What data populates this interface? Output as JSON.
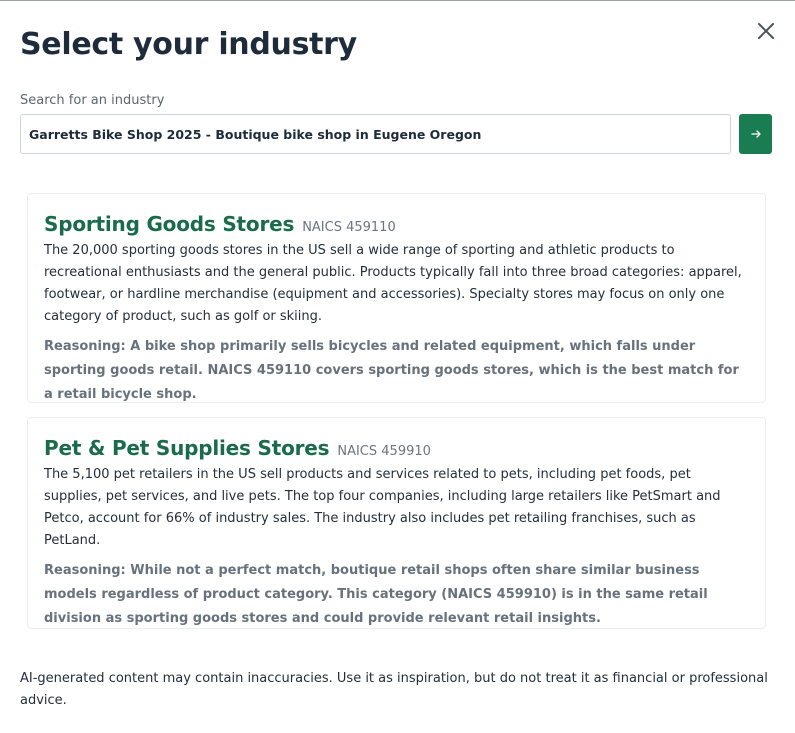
{
  "modal": {
    "title": "Select your industry",
    "close_icon": "close-icon"
  },
  "search": {
    "label": "Search for an industry",
    "value": "Garretts Bike Shop 2025 - Boutique bike shop in Eugene Oregon",
    "submit_icon": "arrow-right-icon",
    "accent_color": "#1a7d52"
  },
  "results": [
    {
      "title": "Sporting Goods Stores",
      "naics": "NAICS 459110",
      "description": "The 20,000 sporting goods stores in the US sell a wide range of sporting and athletic products to recreational enthusiasts and the general public. Products typically fall into three broad categories: apparel, footwear, or hardline merchandise (equipment and accessories). Specialty stores may focus on only one category of product, such as golf or skiing.",
      "reasoning": "Reasoning: A bike shop primarily sells bicycles and related equipment, which falls under sporting goods retail. NAICS 459110 covers sporting goods stores, which is the best match for a retail bicycle shop."
    },
    {
      "title": "Pet & Pet Supplies Stores",
      "naics": "NAICS 459910",
      "description": "The 5,100 pet retailers in the US sell products and services related to pets, including pet foods, pet supplies, pet services, and live pets. The top four companies, including large retailers like PetSmart and Petco, account for 66% of industry sales. The industry also includes pet retailing franchises, such as PetLand.",
      "reasoning": "Reasoning: While not a perfect match, boutique retail shops often share similar business models regardless of product category. This category (NAICS 459910) is in the same retail division as sporting goods stores and could provide relevant retail insights."
    }
  ],
  "disclaimer": "AI-generated content may contain inaccuracies. Use it as inspiration, but do not treat it as financial or professional advice.",
  "colors": {
    "title": "#1e2b3a",
    "result_title": "#1a6b4b",
    "muted": "#68727c"
  }
}
